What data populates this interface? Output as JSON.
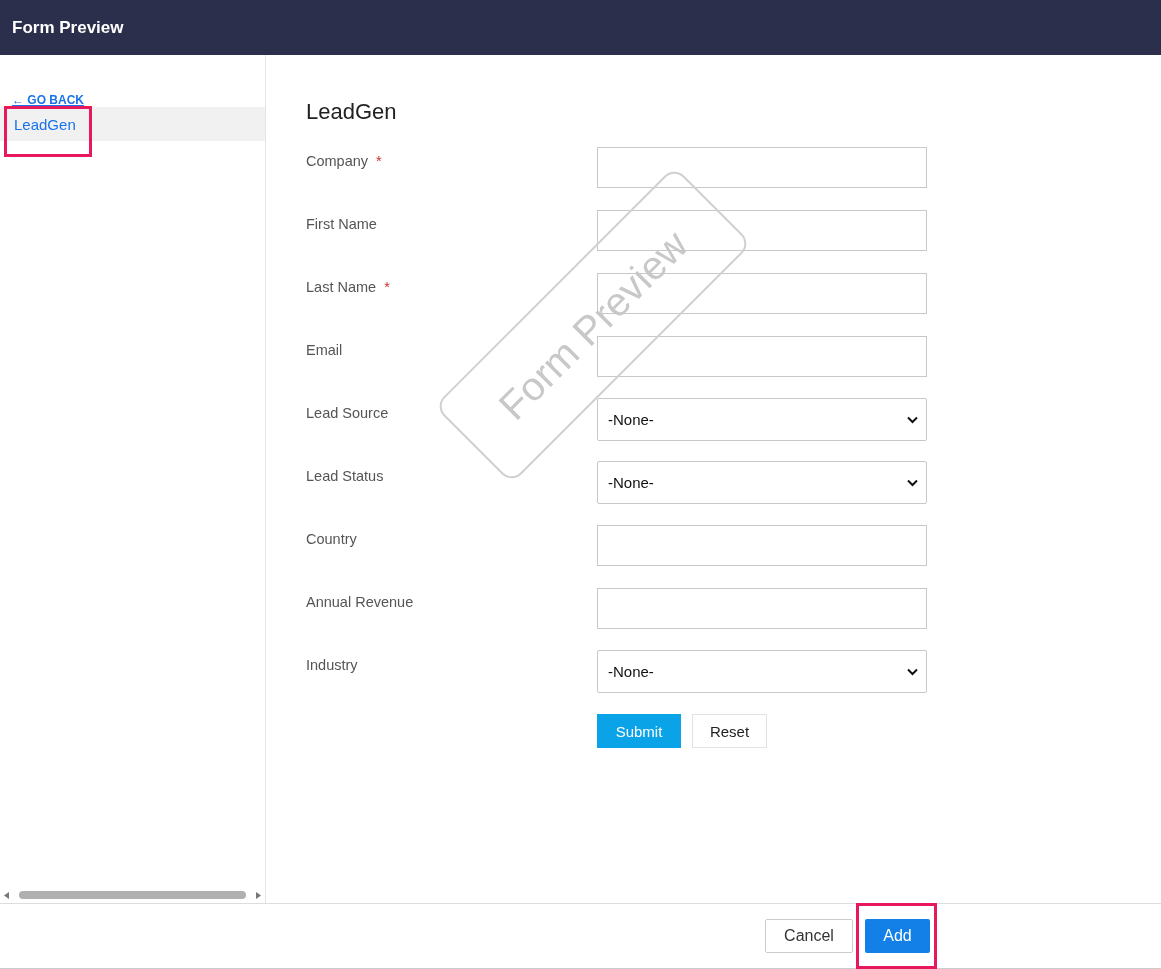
{
  "header": {
    "title": "Form Preview"
  },
  "sidebar": {
    "back_link": "← GO BACK",
    "items": [
      {
        "label": "LeadGen",
        "selected": true,
        "highlighted": true
      }
    ]
  },
  "form": {
    "title": "LeadGen",
    "stamp": "Form Preview",
    "fields": [
      {
        "label": "Company",
        "marker": "*",
        "kind": "text"
      },
      {
        "label": "First Name",
        "kind": "text"
      },
      {
        "label": "Last Name",
        "marker": "*",
        "kind": "text"
      },
      {
        "label": "Email",
        "kind": "text"
      },
      {
        "label": "Lead Source",
        "kind": "select",
        "value": "-None-"
      },
      {
        "label": "Lead Status",
        "kind": "select",
        "value": "-None-"
      },
      {
        "label": "Country",
        "kind": "text"
      },
      {
        "label": "Annual Revenue",
        "kind": "text"
      },
      {
        "label": "Industry",
        "kind": "select",
        "value": "-None-"
      }
    ],
    "submit": "Submit",
    "reset": "Reset"
  },
  "footer": {
    "cancel": "Cancel",
    "add": {
      "label": "Add",
      "highlighted": true
    }
  }
}
